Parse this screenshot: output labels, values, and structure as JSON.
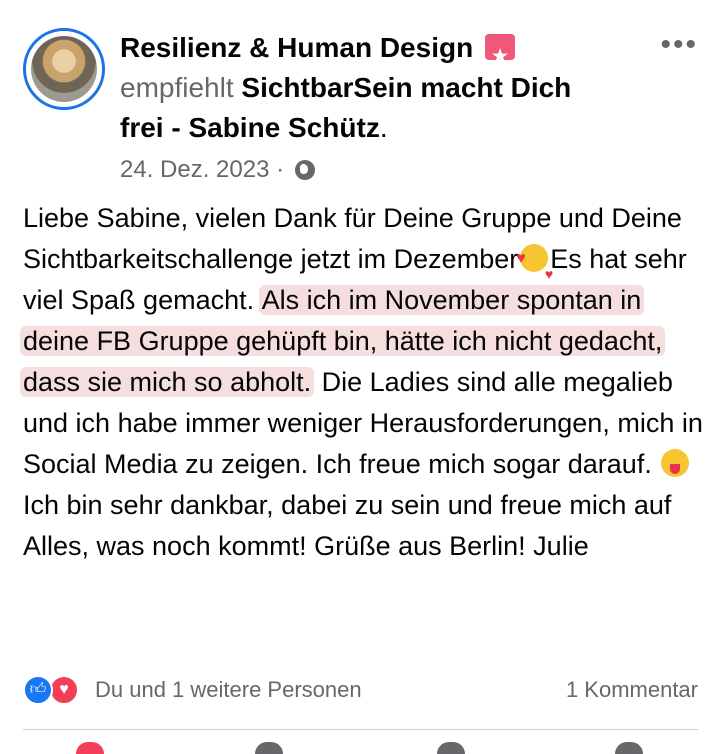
{
  "post": {
    "author_name": "Resilienz & Human Design",
    "recommend_verb": "empfiehlt",
    "recommended_page_line1": "SichtbarSein macht Dich",
    "recommended_page_line2": "frei - Sabine Schütz",
    "recommended_page_suffix": ".",
    "date": "24. Dez. 2023",
    "date_separator": "·",
    "more_label": "•••",
    "body": {
      "part1": "Liebe Sabine, vielen Dank für Deine Gruppe und Deine Sichtbarkeitschallenge jetzt im Dezember",
      "emoji1": "smiling-face-with-hearts",
      "part2": "Es hat sehr viel Spaß gemacht. ",
      "highlighted": "Als ich im November spontan in deine FB Gruppe gehüpft bin, hätte ich nicht gedacht, dass sie mich so abholt.",
      "part3": " Die Ladies sind alle megalieb und ich habe immer weniger Herausforderungen, mich in Social Media zu zeigen. Ich freue mich sogar darauf. ",
      "emoji2": "zany-face",
      "part4": "Ich bin sehr dankbar, dabei zu sein und freue mich auf Alles, was noch kommt! Grüße aus Berlin! Julie"
    },
    "reactions_text": "Du und 1 weitere Personen",
    "comments_text": "1 Kommentar"
  },
  "icons": {
    "badge": "recommendation-star-badge-icon",
    "privacy": "globe-icon",
    "like": "like-reaction-icon",
    "love": "love-reaction-icon"
  },
  "colors": {
    "accent": "#1b74e4",
    "highlight": "#f4dede",
    "secondary_text": "#65676b",
    "like_blue": "#1877f2",
    "love_red": "#f33e58"
  }
}
